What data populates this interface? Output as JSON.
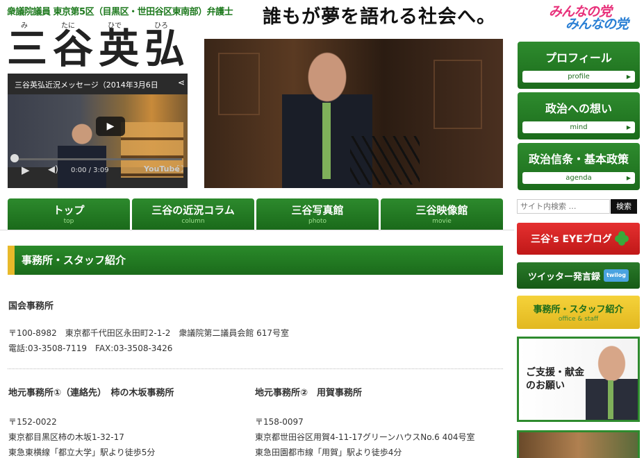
{
  "header": {
    "subtitle": "衆議院議員 東京第5区（目黒区・世田谷区東南部）弁護士",
    "slogan": "誰もが夢を語れる社会へ。",
    "party_logo_line1": "みんなの党",
    "party_logo_line2": "みんなの党",
    "ruby": [
      "み",
      "たに",
      "ひで",
      "ひろ"
    ],
    "name": "三谷英弘"
  },
  "video": {
    "title": "三谷英弘近況メッセージ（2014年3月6日",
    "time": "0:00 / 3:09",
    "brand": "YouTube"
  },
  "top_nav": [
    {
      "label": "トップ",
      "sub": "top"
    },
    {
      "label": "三谷の近況コラム",
      "sub": "column"
    },
    {
      "label": "三谷写真館",
      "sub": "photo"
    },
    {
      "label": "三谷映像館",
      "sub": "movie"
    }
  ],
  "sidebar": {
    "buttons": [
      {
        "label": "プロフィール",
        "sub": "profile"
      },
      {
        "label": "政治への想い",
        "sub": "mind"
      },
      {
        "label": "政治信条・基本政策",
        "sub": "agenda"
      }
    ],
    "search_placeholder": "サイト内検索 …",
    "search_button": "検索",
    "blog_label": "三谷's EYEブログ",
    "twitter_label": "ツイッター発言録",
    "twilog_badge": "twilog",
    "office_label": "事務所・スタッフ紹介",
    "office_sub": "office & staff",
    "support_line1": "ご支援・献金",
    "support_line2": "のお願い"
  },
  "main": {
    "section_title": "事務所・スタッフ紹介",
    "kokkai": {
      "title": "国会事務所",
      "address": "〒100-8982　東京都千代田区永田町2-1-2　衆議院第二議員会館 617号室",
      "phone": "電話:03-3508-7119　FAX:03-3508-3426"
    },
    "local1": {
      "title": "地元事務所①（連絡先）　柿の木坂事務所",
      "zip": "〒152-0022",
      "address": "東京都目黒区柿の木坂1-32-17",
      "access": "東急東横線「都立大学」駅より徒歩5分"
    },
    "local2": {
      "title": "地元事務所②　用賀事務所",
      "zip": "〒158-0097",
      "address": "東京都世田谷区用賀4-11-17グリーンハウスNo.6 404号室",
      "access": "東急田園都市線「用賀」駅より徒歩4分"
    }
  },
  "colors": {
    "green": "#1b6b1b",
    "accent_yellow": "#e8b92a",
    "blog_red": "#c01818"
  }
}
